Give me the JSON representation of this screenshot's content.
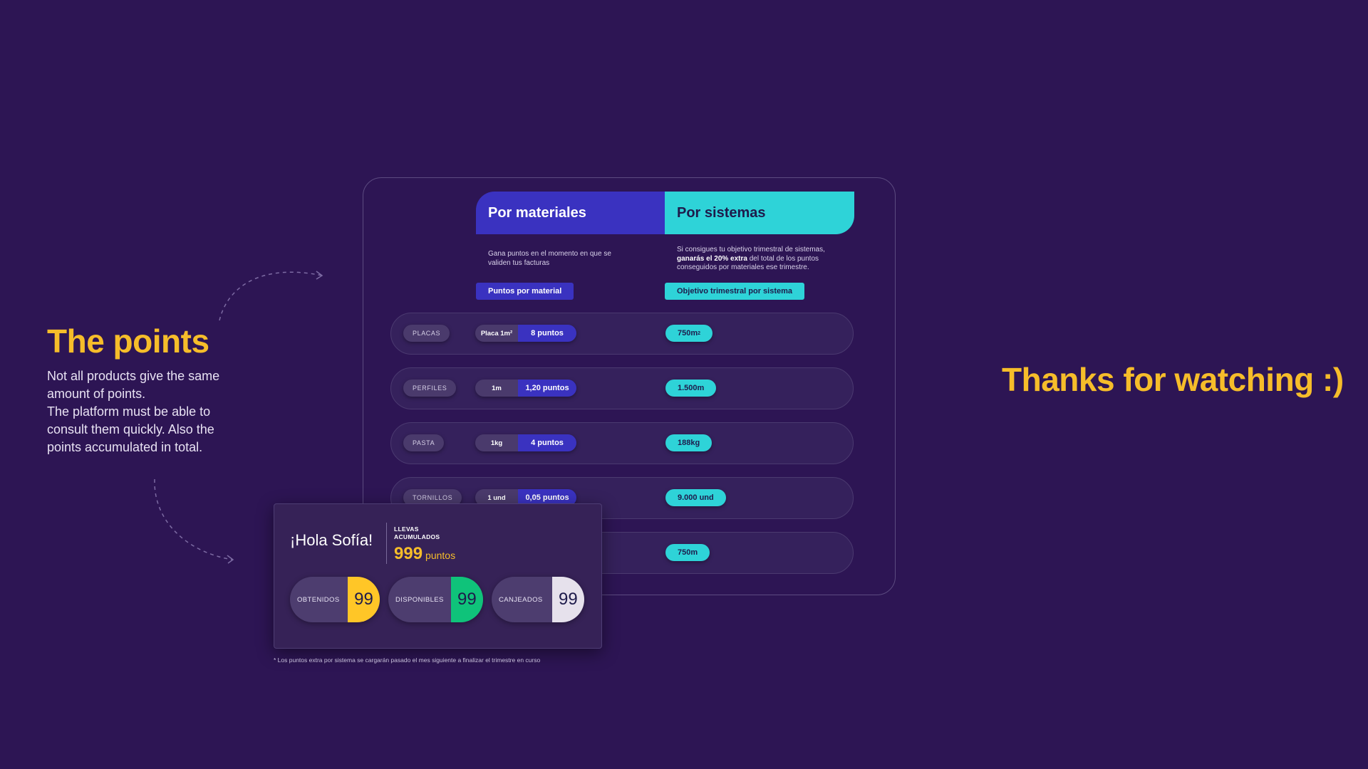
{
  "left": {
    "title": "The points",
    "lines": [
      "Not all products give the same",
      "amount of points.",
      "The platform must be able to",
      "consult them quickly. Also the",
      "points accumulated in total."
    ]
  },
  "right": {
    "thanks": "Thanks for watching :)"
  },
  "table": {
    "materials": {
      "header": "Por materiales",
      "description": "Gana puntos en el momento en que se validen tus facturas",
      "tag": "Puntos por material"
    },
    "systems": {
      "header": "Por sistemas",
      "description_pre": "Si consigues tu objetivo trimestral de sistemas,",
      "description_bold": "ganarás el 20% extra",
      "description_post": "del total de los puntos conseguidos por materiales ese trimestre.",
      "tag": "Objetivo trimestral por sistema"
    },
    "rows": [
      {
        "label": "PLACAS",
        "unit": "Placa 1m²",
        "points": "8 puntos",
        "target": "750m",
        "target_sup": "2"
      },
      {
        "label": "PERFILES",
        "unit": "1m",
        "points": "1,20 puntos",
        "target": "1.500m",
        "target_sup": ""
      },
      {
        "label": "PASTA",
        "unit": "1kg",
        "points": "4 puntos",
        "target": "188kg",
        "target_sup": ""
      },
      {
        "label": "TORNILLOS",
        "unit": "1 und",
        "points": "0,05 puntos",
        "target": "9.000 und",
        "target_sup": ""
      },
      {
        "label": "",
        "unit": "",
        "points": "",
        "target": "750m",
        "target_sup": ""
      }
    ]
  },
  "card": {
    "greeting": "¡Hola Sofía!",
    "accum_line1": "LLEVAS",
    "accum_line2": "ACUMULADOS",
    "total": "999",
    "total_unit": "puntos",
    "stats": [
      {
        "label": "OBTENIDOS",
        "value": "99",
        "color": "#ffc627"
      },
      {
        "label": "DISPONIBLES",
        "value": "99",
        "color": "#0fc37a"
      },
      {
        "label": "CANJEADOS",
        "value": "99",
        "color": "#e6e1ec"
      }
    ]
  },
  "footnote": "* Los puntos extra por sistema se cargarán pasado el mes siguiente a finalizar el trimestre en curso",
  "colors": {
    "background": "#2d1554",
    "accent_yellow": "#f6bd2a",
    "materials_blue": "#3a32c0",
    "systems_cyan": "#2ed3d8"
  }
}
